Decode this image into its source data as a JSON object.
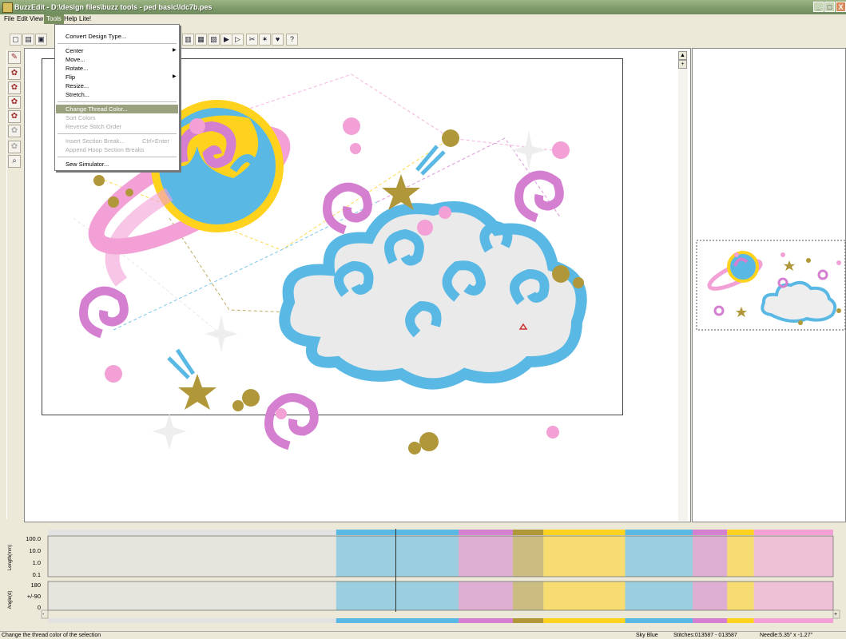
{
  "title_bar": {
    "title": "BuzzEdit - D:\\design files\\buzz tools - ped basic\\ldc7b.pes",
    "minimize": "_",
    "maximize": "□",
    "close": "X"
  },
  "menu": {
    "file": "File",
    "edit": "Edit",
    "view": "View",
    "tools": "Tools",
    "help": "Help",
    "lite": "Lite!"
  },
  "tools_menu": {
    "convert": "Convert Design Type...",
    "center": "Center",
    "move": "Move...",
    "rotate": "Rotate...",
    "flip": "Flip",
    "resize": "Resize...",
    "stretch": "Stretch...",
    "change_thread_color": "Change Thread Color...",
    "sort_colors": "Sort Colors",
    "reverse_stitch": "Reverse Stitch Order",
    "insert_section": "Insert Section Break...",
    "insert_shortcut": "Ctrl+Enter",
    "append_hoop": "Append Hoop Section Breaks",
    "sew_simulator": "Sew Simulator..."
  },
  "graph": {
    "length_label": "Length(mm)",
    "angle_label": "Angle(d)",
    "length_ticks": [
      "100.0",
      "10.0",
      "1.0",
      "0.1"
    ],
    "angle_ticks": [
      "180",
      "+/-90",
      "0"
    ],
    "color_segments": [
      {
        "color": "#e2e2e2",
        "fraction": 0.367
      },
      {
        "color": "#5ab8e4",
        "fraction": 0.156
      },
      {
        "color": "#d47fcf",
        "fraction": 0.069
      },
      {
        "color": "#b0983a",
        "fraction": 0.039
      },
      {
        "color": "#ffd21e",
        "fraction": 0.104
      },
      {
        "color": "#5ab8e4",
        "fraction": 0.086
      },
      {
        "color": "#d47fcf",
        "fraction": 0.044
      },
      {
        "color": "#ffd21e",
        "fraction": 0.034
      },
      {
        "color": "#f2a0d6",
        "fraction": 0.101
      }
    ],
    "cursor_position": 0.443
  },
  "status": {
    "message": "Change the thread color of the selection",
    "color_name": "Sky Blue",
    "stitches": "Stitches:013587 - 013587",
    "needle": "Needle:5.35\" x -1.27\""
  },
  "colors": {
    "pink": "#f2a0d6",
    "violet": "#d47fcf",
    "blue": "#5ab8e4",
    "yellow": "#ffd21e",
    "gold": "#b0983a",
    "grey": "#e2e2e2"
  }
}
